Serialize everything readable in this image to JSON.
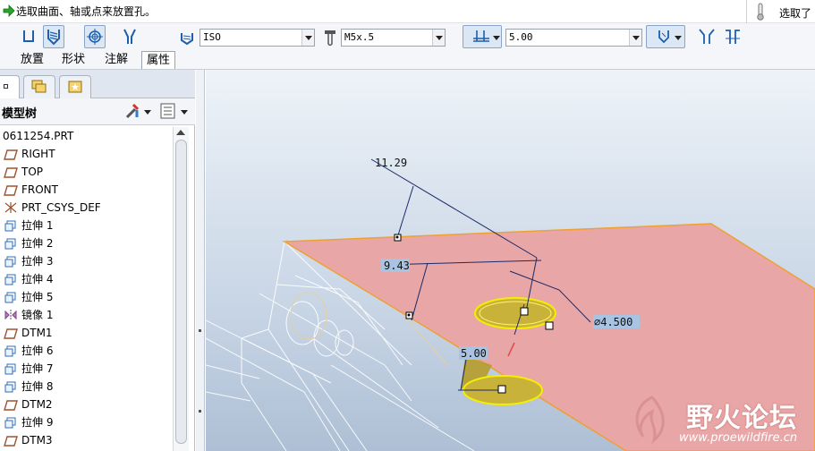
{
  "message": {
    "text": "选取曲面、轴或点来放置孔。",
    "selection_label": "选取了"
  },
  "toolbar": {
    "standard_value": "ISO",
    "screw_size_value": "M5x.5",
    "depth_value": "5.00"
  },
  "tabs": [
    {
      "label": "放置"
    },
    {
      "label": "形状"
    },
    {
      "label": "注解"
    },
    {
      "label": "属性"
    }
  ],
  "tree": {
    "title": "模型树",
    "items": [
      {
        "label": "0611254.PRT",
        "icon": "part-icon"
      },
      {
        "label": "RIGHT",
        "icon": "datum-plane-icon"
      },
      {
        "label": "TOP",
        "icon": "datum-plane-icon"
      },
      {
        "label": "FRONT",
        "icon": "datum-plane-icon"
      },
      {
        "label": "PRT_CSYS_DEF",
        "icon": "csys-icon"
      },
      {
        "label": "拉伸 1",
        "icon": "extrude-icon"
      },
      {
        "label": "拉伸 2",
        "icon": "extrude-icon"
      },
      {
        "label": "拉伸 3",
        "icon": "extrude-icon"
      },
      {
        "label": "拉伸 4",
        "icon": "extrude-icon"
      },
      {
        "label": "拉伸 5",
        "icon": "extrude-icon"
      },
      {
        "label": "镜像 1",
        "icon": "mirror-icon"
      },
      {
        "label": "DTM1",
        "icon": "datum-plane-icon"
      },
      {
        "label": "拉伸 6",
        "icon": "extrude-icon"
      },
      {
        "label": "拉伸 7",
        "icon": "extrude-icon"
      },
      {
        "label": "拉伸 8",
        "icon": "extrude-icon"
      },
      {
        "label": "DTM2",
        "icon": "datum-plane-icon"
      },
      {
        "label": "拉伸 9",
        "icon": "extrude-icon"
      },
      {
        "label": "DTM3",
        "icon": "datum-plane-icon"
      }
    ]
  },
  "dimensions": {
    "d1": "11.29",
    "d2": "9.43",
    "diameter": "∅4.500",
    "depth": "5.00"
  },
  "watermark": {
    "brand": "野火论坛",
    "url": "www.proewildfire.cn"
  },
  "colors": {
    "surface": "#e9a6a6",
    "hole": "#e0e000",
    "accent": "#f5a623"
  }
}
